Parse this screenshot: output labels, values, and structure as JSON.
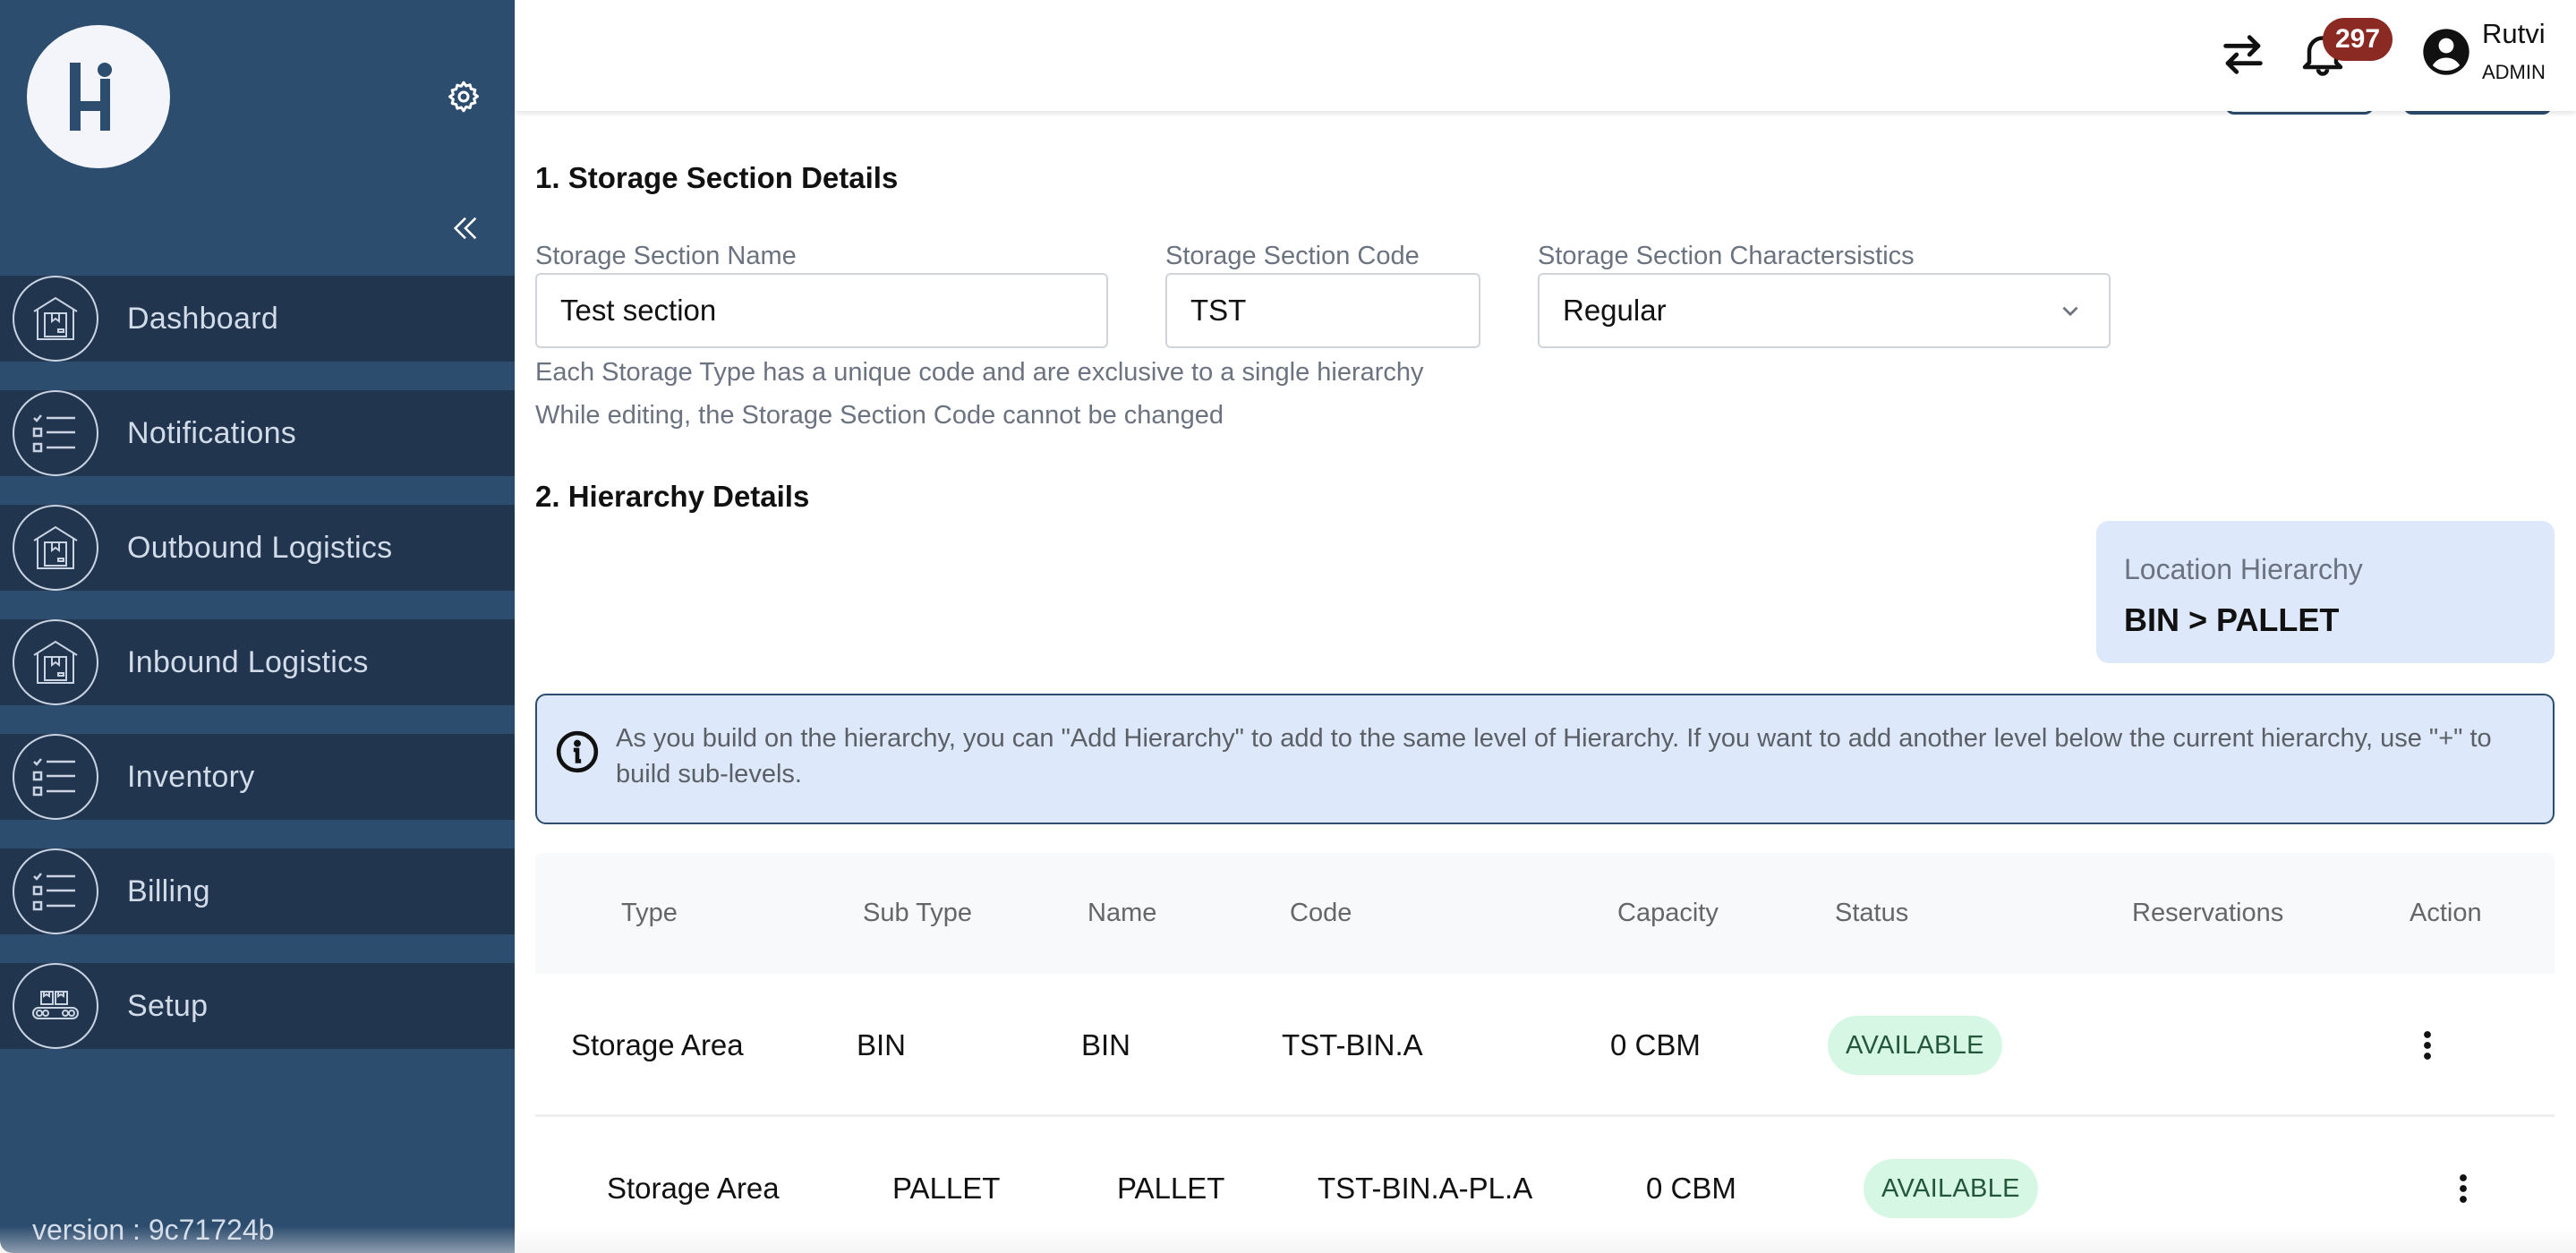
{
  "sidebar": {
    "logo_text": "Hi",
    "items": [
      {
        "label": "Dashboard",
        "icon": "warehouse-icon"
      },
      {
        "label": "Notifications",
        "icon": "checklist-icon"
      },
      {
        "label": "Outbound Logistics",
        "icon": "warehouse-icon"
      },
      {
        "label": "Inbound Logistics",
        "icon": "warehouse-icon"
      },
      {
        "label": "Inventory",
        "icon": "checklist-icon"
      },
      {
        "label": "Billing",
        "icon": "checklist-icon"
      },
      {
        "label": "Setup",
        "icon": "conveyor-icon"
      }
    ],
    "version": "version : 9c71724b"
  },
  "header": {
    "notification_count": "297",
    "user_name": "Rutvi",
    "user_role": "ADMIN"
  },
  "section1": {
    "title": "1. Storage Section Details",
    "name_label": "Storage Section Name",
    "name_value": "Test section",
    "code_label": "Storage Section Code",
    "code_value": "TST",
    "char_label": "Storage Section Charactersistics",
    "char_value": "Regular",
    "help_1": "Each Storage Type has a unique code and are exclusive to a single hierarchy",
    "help_2": "While editing, the Storage Section Code cannot be changed"
  },
  "section2": {
    "title": "2. Hierarchy Details",
    "location_label": "Location Hierarchy",
    "location_value": "BIN > PALLET",
    "info_text": "As you build on the hierarchy, you can \"Add Hierarchy\" to add to the same level of Hierarchy. If you want to add another level below the current hierarchy, use \"+\" to build sub-levels."
  },
  "table": {
    "columns": [
      "Type",
      "Sub Type",
      "Name",
      "Code",
      "Capacity",
      "Status",
      "Reservations",
      "Action"
    ],
    "rows": [
      {
        "type": "Storage Area",
        "sub_type": "BIN",
        "name": "BIN",
        "code": "TST-BIN.A",
        "capacity": "0 CBM",
        "status": "AVAILABLE",
        "reservations": ""
      },
      {
        "type": "Storage Area",
        "sub_type": "PALLET",
        "name": "PALLET",
        "code": "TST-BIN.A-PL.A",
        "capacity": "0 CBM",
        "status": "AVAILABLE",
        "reservations": ""
      }
    ]
  },
  "colors": {
    "sidebar_bg": "#2d4d6f",
    "nav_item_bg": "#22354f",
    "badge_bg": "#8b2a23",
    "info_bg": "#dde8fa",
    "status_available_bg": "#d7f7e5",
    "status_available_fg": "#23573a"
  }
}
